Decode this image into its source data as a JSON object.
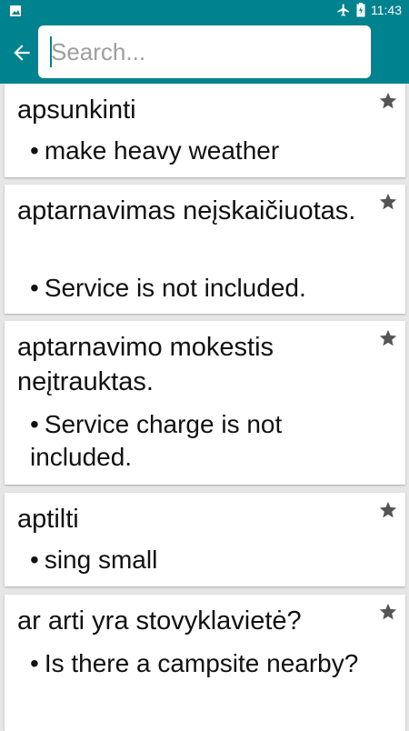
{
  "status": {
    "time": "11:43"
  },
  "search": {
    "placeholder": "Search..."
  },
  "entries": [
    {
      "term": "apsunkinti",
      "translation": "make heavy weather"
    },
    {
      "term": "aptarnavimas neįskaičiuotas.",
      "translation": "Service is not included."
    },
    {
      "term": "aptarnavimo mokestis neįtrauktas.",
      "translation": "Service charge is not included."
    },
    {
      "term": "aptilti",
      "translation": "sing small"
    },
    {
      "term": "ar arti yra stovyklavietė?",
      "translation": "Is there a campsite nearby?"
    }
  ],
  "colors": {
    "accent": "#00838f",
    "background": "#e6e6e6",
    "star": "#555555"
  },
  "icons": {
    "back": "arrow-left-icon",
    "favorite": "star-icon",
    "airplane": "airplane-icon",
    "battery": "battery-icon",
    "gallery": "image-icon"
  }
}
